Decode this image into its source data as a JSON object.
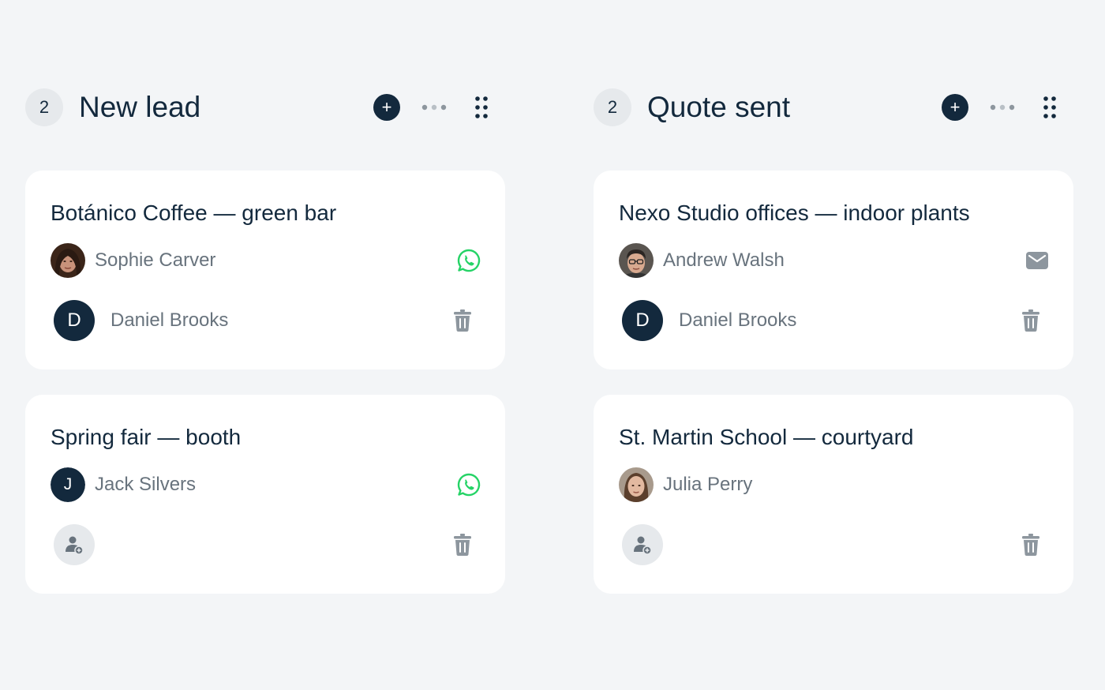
{
  "columns": [
    {
      "count": "2",
      "title": "New lead",
      "cards": [
        {
          "title": "Botánico Coffee — green bar",
          "contact": {
            "name": "Sophie Carver",
            "avatar": "photo",
            "channel": "whatsapp-icon"
          },
          "owner": {
            "name": "Daniel Brooks",
            "initial": "D"
          }
        },
        {
          "title": "Spring fair — booth",
          "contact": {
            "name": "Jack Silvers",
            "avatar": "initial",
            "initial": "J",
            "channel": "whatsapp-icon"
          },
          "owner": {
            "name": "",
            "initial": ""
          }
        }
      ]
    },
    {
      "count": "2",
      "title": "Quote sent",
      "cards": [
        {
          "title": "Nexo Studio offices — indoor plants",
          "contact": {
            "name": "Andrew Walsh",
            "avatar": "photo",
            "channel": "email-icon"
          },
          "owner": {
            "name": "Daniel Brooks",
            "initial": "D"
          }
        },
        {
          "title": "St. Martin School — courtyard",
          "contact": {
            "name": "Julia Perry",
            "avatar": "photo",
            "channel": ""
          },
          "owner": {
            "name": "",
            "initial": ""
          }
        }
      ]
    }
  ],
  "colors": {
    "background": "#f3f5f7",
    "navy": "#13293d",
    "muted_text": "#68737d",
    "icon_gray": "#8d969e",
    "whatsapp_green": "#25d366",
    "badge_bg": "#e6e9ec"
  }
}
